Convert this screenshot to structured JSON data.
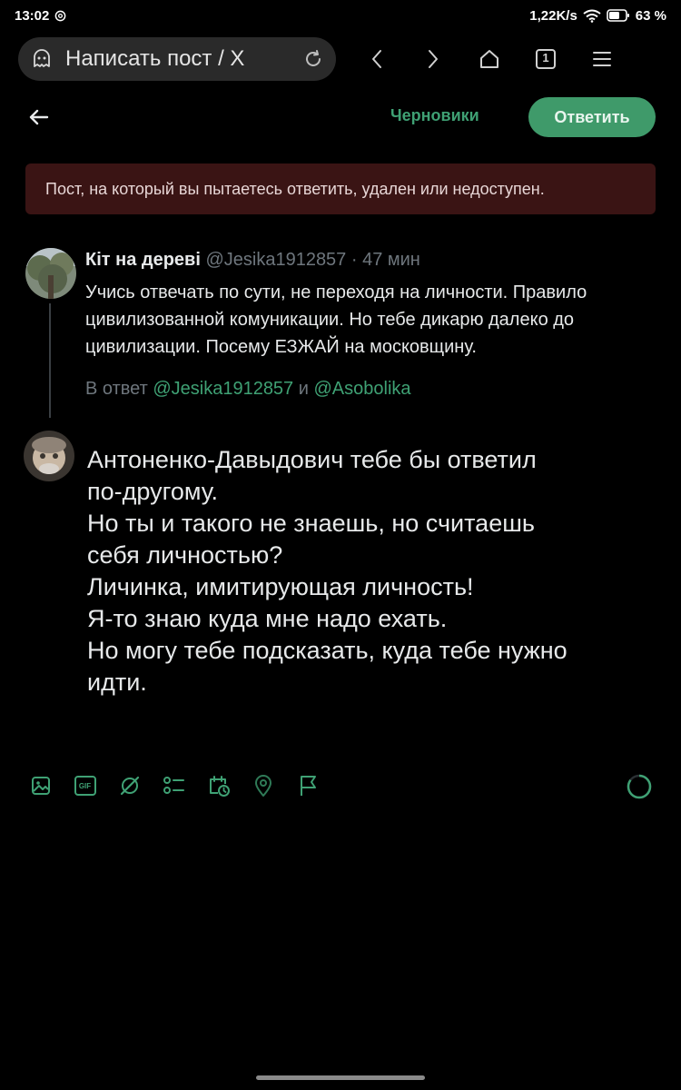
{
  "status_bar": {
    "time": "13:02",
    "network_speed": "1,22K/s",
    "battery": "63 %"
  },
  "browser": {
    "url_title": "Написать пост / X",
    "tab_count": "1"
  },
  "header": {
    "drafts_label": "Черновики",
    "reply_label": "Ответить"
  },
  "error_banner": {
    "text": "Пост, на который вы пытаетесь ответить, удален или недоступен."
  },
  "original_tweet": {
    "author_name": "Кіт на дереві",
    "handle_time": "@Jesika1912857 · 47 мин",
    "body": "Учись отвечать по сути, не переходя на личности. Правило цивилизованной комуникации. Но тебе дикарю далеко до цивилизации. Посему ЕЗЖАЙ на московщину.",
    "reply_prefix": "В ответ",
    "mention_1": "@Jesika1912857",
    "reply_joiner": "и",
    "mention_2": "@Asobolika"
  },
  "compose": {
    "lines": [
      "Антоненко-Давыдович тебе бы ответил",
      "по-другому.",
      "Но ты и такого не знаешь, но считаешь",
      "себя личностью?",
      "Личинка, имитирующая личность!",
      "Я-то знаю куда мне надо ехать.",
      "Но могу тебе подсказать, куда тебе нужно",
      "идти."
    ]
  },
  "toolbar": {
    "icons": [
      "image-icon",
      "gif-icon",
      "grok-icon",
      "poll-icon",
      "schedule-icon",
      "location-icon",
      "flag-icon"
    ],
    "gif_label": "GIF"
  },
  "colors": {
    "accent_green": "#3fa174",
    "button_green": "#3f9a6a",
    "error_bg": "#3a1414",
    "muted_text": "#6e767d"
  }
}
